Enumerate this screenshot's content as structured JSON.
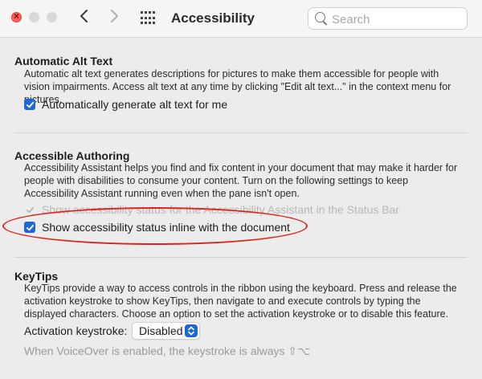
{
  "window": {
    "title": "Accessibility"
  },
  "search": {
    "placeholder": "Search"
  },
  "icons": {
    "close": "close-icon",
    "minimize": "minimize-icon",
    "zoom": "zoom-icon",
    "back": "chevron-left-icon",
    "forward": "chevron-right-icon",
    "grid": "grid-icon",
    "search": "search-icon",
    "check": "checkmark-icon",
    "updown": "updown-chevron-icon"
  },
  "colors": {
    "accent": "#1f67d2",
    "close": "#ff5f57",
    "annotation": "#e0231a",
    "disabled_text": "#b7b7b7"
  },
  "alt_text": {
    "title": "Automatic Alt Text",
    "description": "Automatic alt text generates descriptions for pictures to make them accessible for people with vision impairments. Access alt text at any time by clicking \"Edit alt text...\" in the context menu for pictures.",
    "checkbox_label": "Automatically generate alt text for me",
    "checked": true
  },
  "authoring": {
    "title": "Accessible Authoring",
    "description": "Accessibility Assistant helps you find and fix content in your document that may make it harder for people with disabilities to consume your content. Turn on the following settings to keep Accessibility Assistant running even when the pane isn't open.",
    "status_bar_label": "Show accessibility status for the Accessibility Assistant in the Status Bar",
    "status_bar_checked": true,
    "status_bar_enabled": false,
    "inline_label": "Show accessibility status inline with the document",
    "inline_checked": true
  },
  "keytips": {
    "title": "KeyTips",
    "description": "KeyTips provide a way to access controls in the ribbon using the keyboard. Press and release the activation keystroke to show KeyTips, then navigate to and execute controls by typing the displayed characters. Choose an option to set the activation keystroke or to disable this feature.",
    "activation_label": "Activation keystroke:",
    "activation_value": "Disabled",
    "voiceover_note": "When VoiceOver is enabled, the keystroke is always ⇧⌥"
  }
}
